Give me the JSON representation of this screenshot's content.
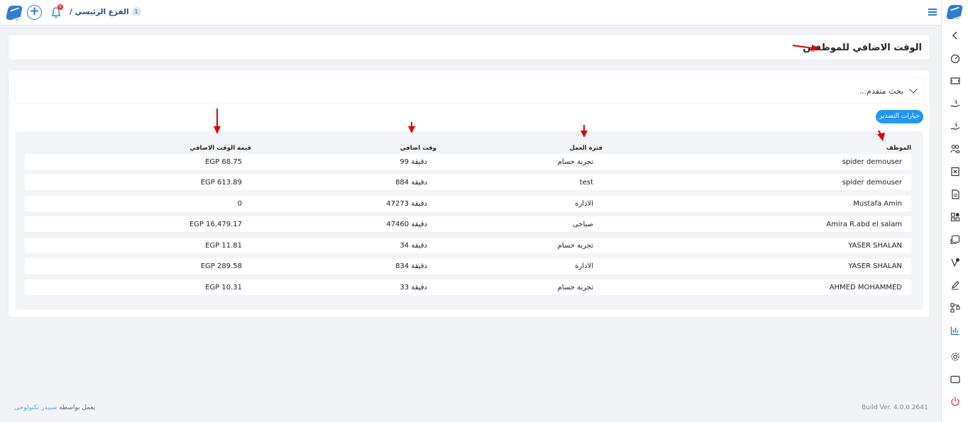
{
  "topbar": {
    "branch_name": "الفرع الرئيسي /",
    "branch_count": "1",
    "notif_count": "5"
  },
  "page": {
    "title": "الوقت الاضافي للموظفين"
  },
  "search": {
    "label": "بحث متقدم..."
  },
  "export_label": "خيارات التصدير",
  "table": {
    "headers": {
      "employee": "الموظف",
      "shift": "فترة العمل",
      "overtime": "وقت اضافي",
      "value": "قيمة الوقت الاضافي"
    },
    "rows": [
      {
        "employee": "spider demouser",
        "shift": "تجربة حسام",
        "overtime": "99 دقيقة",
        "value": "EGP 68.75"
      },
      {
        "employee": "spider demouser",
        "shift": "test",
        "overtime": "884 دقيقة",
        "value": "EGP 613.89"
      },
      {
        "employee": "Mustafa Amin",
        "shift": "الادارة",
        "overtime": "47273 دقيقة",
        "value": "0"
      },
      {
        "employee": "Amira R.abd el salam",
        "shift": "صباحى",
        "overtime": "47460 دقيقة",
        "value": "EGP 16,479.17"
      },
      {
        "employee": "YASER SHALAN",
        "shift": "تجربة حسام",
        "overtime": "34 دقيقة",
        "value": "EGP 11.81"
      },
      {
        "employee": "YASER SHALAN",
        "shift": "الادارة",
        "overtime": "834 دقيقة",
        "value": "EGP 289.58"
      },
      {
        "employee": "AHMED MOHAMMED",
        "shift": "تجربة حسام",
        "overtime": "33 دقيقة",
        "value": "EGP 10.31"
      }
    ]
  },
  "footer": {
    "powered_prefix": "يعمل بواسطة",
    "powered_brand": "سبيدر تكنولوجى",
    "build": "Build Ver. 4.0.0.2641"
  },
  "colors": {
    "accent": "#2d7dd2",
    "export_button": "#2196f3",
    "annotation_arrow": "#e00000",
    "power_icon": "#e53935"
  },
  "icons": {
    "sidebar": [
      "collapse-chevron-icon",
      "dashboard-gauge-icon",
      "ticket-icon",
      "salary-hand-icon",
      "payment-hand-icon",
      "users-settings-icon",
      "cancel-document-icon",
      "document-icon",
      "apps-add-icon",
      "payroll-screen-icon",
      "approval-icon",
      "edit-sign-icon",
      "workflow-icon",
      "reports-chart-icon",
      "settings-gear-icon",
      "window-icon",
      "power-icon"
    ]
  }
}
